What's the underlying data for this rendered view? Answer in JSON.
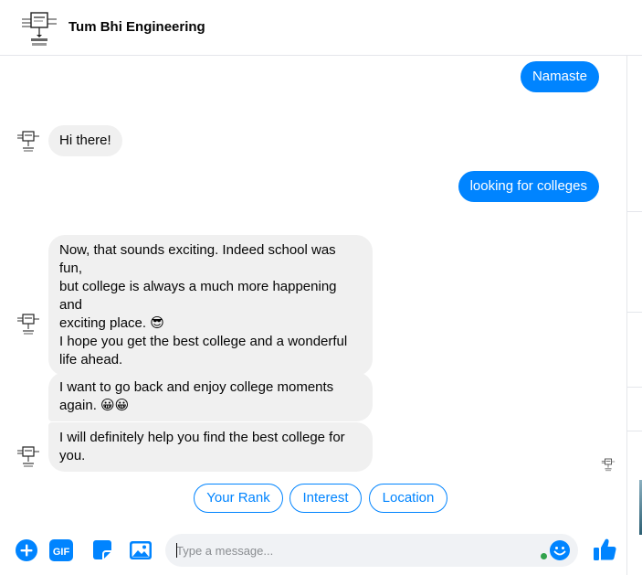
{
  "header": {
    "title": "Tum Bhi Engineering",
    "logo_icon": "engineer-flowchart-logo"
  },
  "messages": [
    {
      "from": "user",
      "text": "Namaste"
    },
    {
      "from": "bot",
      "text": "Hi there!"
    },
    {
      "from": "user",
      "text": "looking for colleges"
    },
    {
      "from": "bot",
      "lines": [
        "Now, that sounds exciting. Indeed school was fun,",
        "but college is always a much more happening and",
        "exciting place. 😎",
        "I hope you get the best college and a wonderful",
        "life ahead."
      ]
    },
    {
      "from": "bot",
      "lines": [
        "I want to go back and enjoy college moments",
        "again. 😀😀"
      ]
    },
    {
      "from": "bot",
      "lines": [
        "I will definitely help you find the best college for",
        "you."
      ]
    }
  ],
  "quick_replies": [
    "Your Rank",
    "Interest",
    "Location"
  ],
  "composer": {
    "placeholder": "Type a message...",
    "icons": [
      "plus-icon",
      "gif-icon",
      "sticker-icon",
      "image-icon",
      "emoji-icon",
      "thumbs-up-icon"
    ]
  },
  "colors": {
    "accent": "#0084ff",
    "bubble_in": "#f0f0f0",
    "online": "#31a24c"
  }
}
